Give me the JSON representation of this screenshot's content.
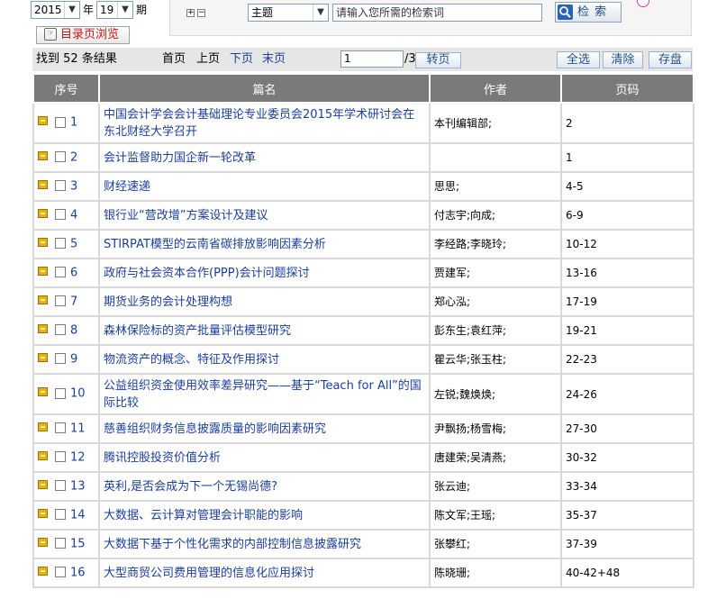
{
  "filters": {
    "year": "2015",
    "year_unit": "年",
    "issue": "19",
    "issue_unit": "期",
    "catalog_button": "目录页浏览"
  },
  "search": {
    "field_option": "主题",
    "placeholder": "请输入您所需的检索词",
    "search_button": "检 索"
  },
  "toolbar": {
    "result_prefix": "找到",
    "result_count": "52",
    "result_suffix": "条结果",
    "first_page": "首页",
    "prev_page": "上页",
    "next_page": "下页",
    "last_page": "末页",
    "page_value": "1",
    "total_pages": "/3",
    "go_button": "转页",
    "select_all": "全选",
    "clear": "清除",
    "save": "存盘"
  },
  "table": {
    "headers": [
      "序号",
      "篇名",
      "作者",
      "页码"
    ],
    "rows": [
      {
        "no": "1",
        "title": "中国会计学会会计基础理论专业委员会2015年学术研讨会在东北财经大学召开",
        "author": "本刊编辑部;",
        "pages": "2"
      },
      {
        "no": "2",
        "title": "会计监督助力国企新一轮改革",
        "author": "",
        "pages": "1"
      },
      {
        "no": "3",
        "title": "财经速递",
        "author": "思思;",
        "pages": "4-5"
      },
      {
        "no": "4",
        "title": "银行业“营改增”方案设计及建议",
        "author": "付志宇;向成;",
        "pages": "6-9"
      },
      {
        "no": "5",
        "title": "STIRPAT模型的云南省碳排放影响因素分析",
        "author": "李经路;李晓玲;",
        "pages": "10-12"
      },
      {
        "no": "6",
        "title": "政府与社会资本合作(PPP)会计问题探讨",
        "author": "贾建军;",
        "pages": "13-16"
      },
      {
        "no": "7",
        "title": "期货业务的会计处理构想",
        "author": "郑心泓;",
        "pages": "17-19"
      },
      {
        "no": "8",
        "title": "森林保险标的资产批量评估模型研究",
        "author": "彭东生;袁红萍;",
        "pages": "19-21"
      },
      {
        "no": "9",
        "title": "物流资产的概念、特征及作用探讨",
        "author": "瞿云华;张玉柱;",
        "pages": "22-23"
      },
      {
        "no": "10",
        "title": "公益组织资金使用效率差异研究——基于“Teach for All”的国际比较",
        "author": "左锐;魏焕焕;",
        "pages": "24-26"
      },
      {
        "no": "11",
        "title": "慈善组织财务信息披露质量的影响因素研究",
        "author": "尹飘扬;杨雪梅;",
        "pages": "27-30"
      },
      {
        "no": "12",
        "title": "腾讯控股投资价值分析",
        "author": "唐建荣;吴清燕;",
        "pages": "30-32"
      },
      {
        "no": "13",
        "title": "英利,是否会成为下一个无锡尚德?",
        "author": "张云迪;",
        "pages": "33-34"
      },
      {
        "no": "14",
        "title": "大数据、云计算对管理会计职能的影响",
        "author": "陈文军;王瑶;",
        "pages": "35-37"
      },
      {
        "no": "15",
        "title": "大数据下基于个性化需求的内部控制信息披露研究",
        "author": "张攀红;",
        "pages": "37-39"
      },
      {
        "no": "16",
        "title": "大型商贸公司费用管理的信息化应用探讨",
        "author": "陈晓珊;",
        "pages": "40-42+48"
      }
    ]
  }
}
